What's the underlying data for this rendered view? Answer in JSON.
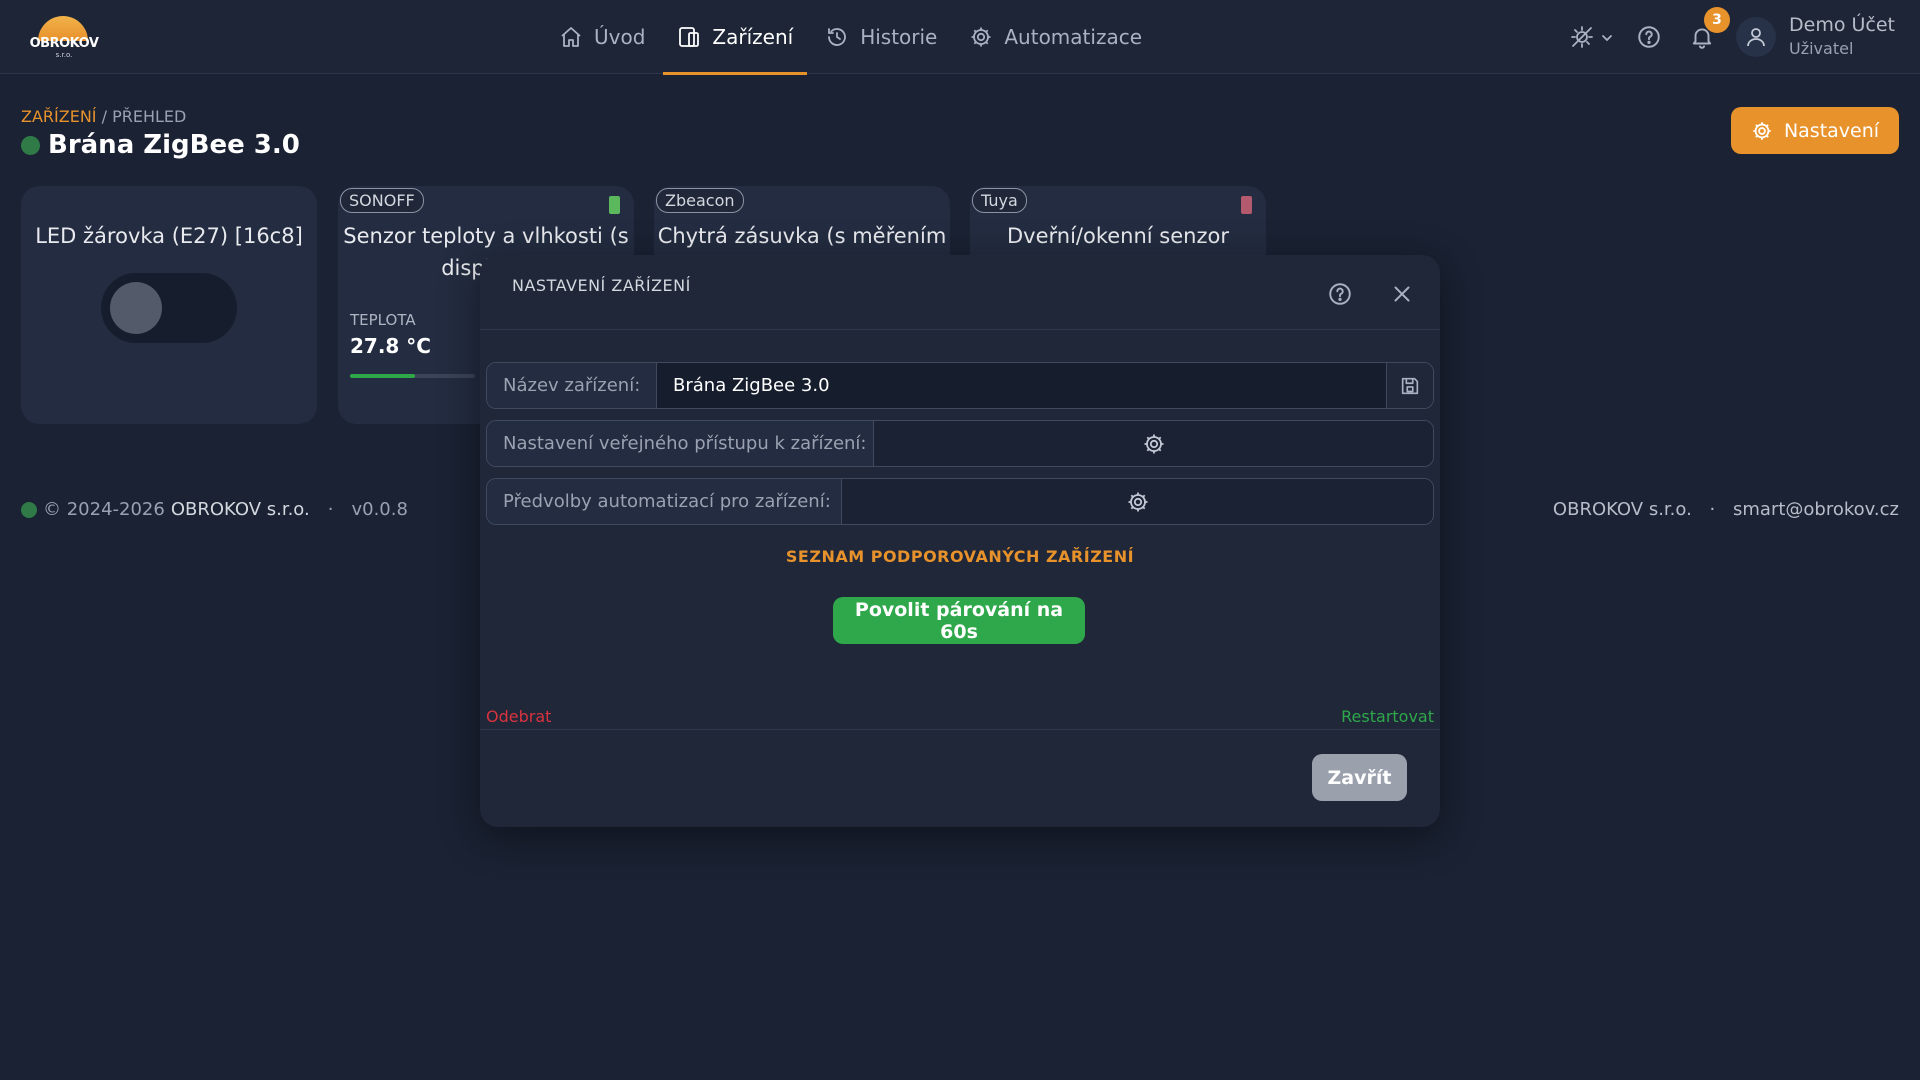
{
  "logo": {
    "text": "OBROKOV",
    "subtext": "s.r.o."
  },
  "nav": {
    "items": [
      {
        "label": "Úvod",
        "icon": "home-icon",
        "active": false
      },
      {
        "label": "Zařízení",
        "icon": "devices-icon",
        "active": true
      },
      {
        "label": "Historie",
        "icon": "history-icon",
        "active": false
      },
      {
        "label": "Automatizace",
        "icon": "gear-icon",
        "active": false
      }
    ]
  },
  "topbar": {
    "notification_count": "3",
    "user_name": "Demo Účet",
    "user_role": "Uživatel",
    "icons": [
      "theme-sun-icon",
      "chevron-down-icon",
      "help-icon",
      "bell-icon",
      "user-icon"
    ]
  },
  "breadcrumb": {
    "root": "ZAŘÍZENÍ",
    "separator": " / ",
    "current": "PŘEHLED"
  },
  "page": {
    "title": "Brána ZigBee 3.0",
    "status_color": "#2f7a47",
    "settings_button": "Nastavení"
  },
  "cards": [
    {
      "tag": "",
      "title": "LED žárovka (E27) [16c8]",
      "toggle_on": false
    },
    {
      "tag": "SONOFF",
      "title": "Senzor teploty a vlhkosti (s displejer",
      "temp_label": "TEPLOTA",
      "temp_value": "27.8 °C",
      "temp_level": 0.52,
      "battery_color": "#5cb85c"
    },
    {
      "tag": "Zbeacon",
      "title": "Chytrá zásuvka (s měřením"
    },
    {
      "tag": "Tuya",
      "title": "Dveřní/okenní senzor",
      "battery_color": "#b45a6e"
    }
  ],
  "footer": {
    "copyright": "© 2024-2026",
    "company": "OBROKOV s.r.o.",
    "separator": "·",
    "version": "v0.0.8",
    "right_company": "OBROKOV s.r.o.",
    "email": "smart@obrokov.cz"
  },
  "modal": {
    "title": "NASTAVENÍ ZAŘÍZENÍ",
    "name_label": "Název zařízení:",
    "name_value": "Brána ZigBee 3.0",
    "public_access_label": "Nastavení veřejného přístupu k zařízení:",
    "automation_presets_label": "Předvolby automatizací pro zařízení:",
    "supported_devices_link": "SEZNAM PODPOROVANÝCH ZAŘÍZENÍ",
    "pairing_button": "Povolit párování na 60s",
    "remove_link": "Odebrat",
    "restart_link": "Restartovat",
    "close_button": "Zavřít"
  },
  "colors": {
    "accent": "#e8922c",
    "success": "#2ea84a",
    "danger": "#d8333f",
    "background": "#1a2233"
  }
}
